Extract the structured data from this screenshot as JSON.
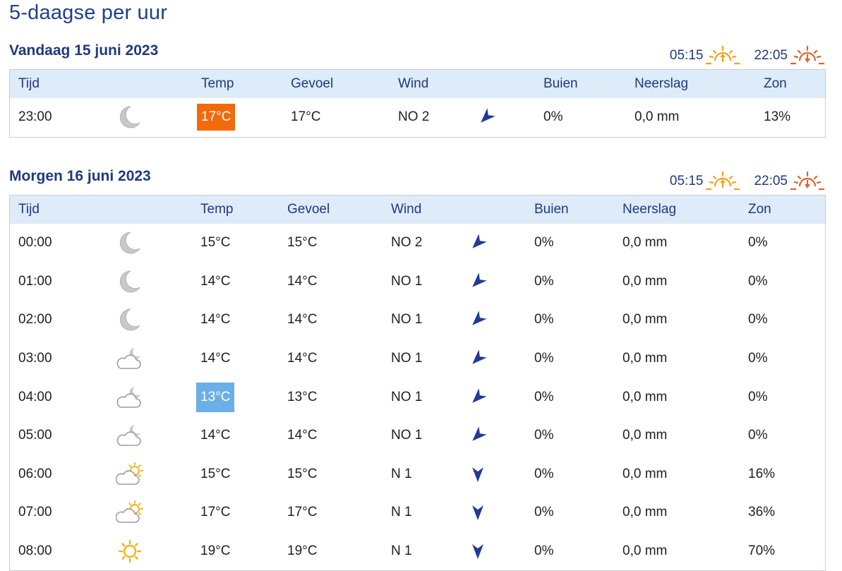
{
  "page": {
    "title": "5-daagse per uur"
  },
  "colors": {
    "brand": "#1f3a80",
    "header_bg": "#deebf8",
    "warm_highlight": "#f26a0a",
    "cold_highlight": "#6aafe6",
    "sunrise": "#f0a21e",
    "sunset": "#e0622a",
    "wind_arrow": "#23389a"
  },
  "columns": [
    "Tijd",
    "Temp",
    "Gevoel",
    "Wind",
    "Buien",
    "Neerslag",
    "Zon"
  ],
  "days": [
    {
      "title": "Vandaag 15 juni 2023",
      "sunrise": "05:15",
      "sunset": "22:05",
      "rows": [
        {
          "time": "23:00",
          "icon": "moon-icon",
          "temp": "17°C",
          "highlight": "warm",
          "feel": "17°C",
          "wind": "NO 2",
          "wind_dir": "NO",
          "showers": "0%",
          "precip": "0,0 mm",
          "sun": "13%"
        }
      ]
    },
    {
      "title": "Morgen 16 juni 2023",
      "sunrise": "05:15",
      "sunset": "22:05",
      "rows": [
        {
          "time": "00:00",
          "icon": "moon-icon",
          "temp": "15°C",
          "highlight": "",
          "feel": "15°C",
          "wind": "NO 2",
          "wind_dir": "NO",
          "showers": "0%",
          "precip": "0,0 mm",
          "sun": "0%"
        },
        {
          "time": "01:00",
          "icon": "moon-icon",
          "temp": "14°C",
          "highlight": "",
          "feel": "14°C",
          "wind": "NO 1",
          "wind_dir": "NO",
          "showers": "0%",
          "precip": "0,0 mm",
          "sun": "0%"
        },
        {
          "time": "02:00",
          "icon": "moon-icon",
          "temp": "14°C",
          "highlight": "",
          "feel": "14°C",
          "wind": "NO 1",
          "wind_dir": "NO",
          "showers": "0%",
          "precip": "0,0 mm",
          "sun": "0%"
        },
        {
          "time": "03:00",
          "icon": "cloud-moon-icon",
          "temp": "14°C",
          "highlight": "",
          "feel": "14°C",
          "wind": "NO 1",
          "wind_dir": "NO",
          "showers": "0%",
          "precip": "0,0 mm",
          "sun": "0%"
        },
        {
          "time": "04:00",
          "icon": "cloud-moon-icon",
          "temp": "13°C",
          "highlight": "cold",
          "feel": "13°C",
          "wind": "NO 1",
          "wind_dir": "NO",
          "showers": "0%",
          "precip": "0,0 mm",
          "sun": "0%"
        },
        {
          "time": "05:00",
          "icon": "cloud-moon-icon",
          "temp": "14°C",
          "highlight": "",
          "feel": "14°C",
          "wind": "NO 1",
          "wind_dir": "NO",
          "showers": "0%",
          "precip": "0,0 mm",
          "sun": "0%"
        },
        {
          "time": "06:00",
          "icon": "cloud-sun-icon",
          "temp": "15°C",
          "highlight": "",
          "feel": "15°C",
          "wind": "N 1",
          "wind_dir": "N",
          "showers": "0%",
          "precip": "0,0 mm",
          "sun": "16%"
        },
        {
          "time": "07:00",
          "icon": "cloud-sun-icon",
          "temp": "17°C",
          "highlight": "",
          "feel": "17°C",
          "wind": "N 1",
          "wind_dir": "N",
          "showers": "0%",
          "precip": "0,0 mm",
          "sun": "36%"
        },
        {
          "time": "08:00",
          "icon": "sun-icon",
          "temp": "19°C",
          "highlight": "",
          "feel": "19°C",
          "wind": "N 1",
          "wind_dir": "N",
          "showers": "0%",
          "precip": "0,0 mm",
          "sun": "70%"
        }
      ]
    }
  ]
}
